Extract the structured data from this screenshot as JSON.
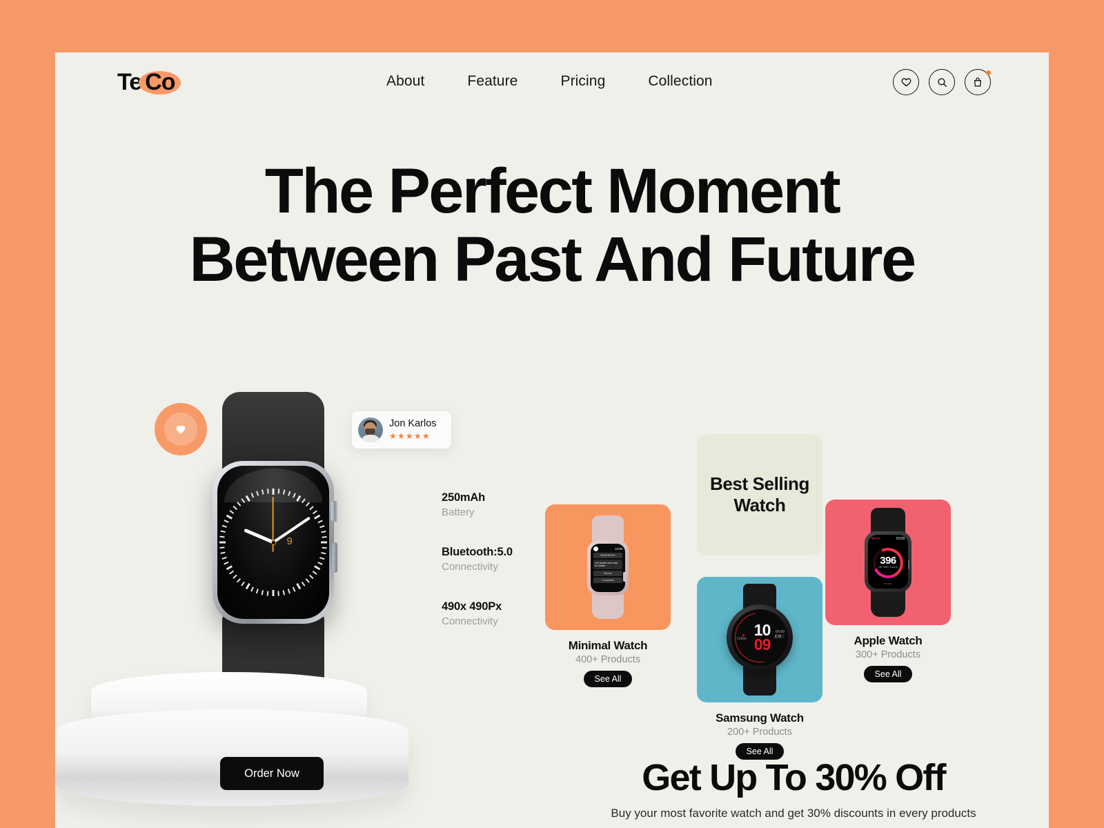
{
  "brand": {
    "name_part1": "Te",
    "name_part2": "Co",
    "accent": "#f79a68"
  },
  "nav": {
    "items": [
      {
        "label": "About"
      },
      {
        "label": "Feature"
      },
      {
        "label": "Pricing"
      },
      {
        "label": "Collection"
      }
    ]
  },
  "header_actions": [
    {
      "icon": "heart-icon",
      "label": "Wishlist"
    },
    {
      "icon": "search-icon",
      "label": "Search"
    },
    {
      "icon": "bag-icon",
      "label": "Cart",
      "badge": true
    }
  ],
  "hero": {
    "line1": "The Perfect Moment",
    "line2": "Between Past And Future"
  },
  "showcase": {
    "favorite_icon": "heart-icon",
    "review": {
      "name": "Jon Karlos",
      "stars": "★★★★★",
      "rating": 5
    },
    "specs": [
      {
        "value": "250mAh",
        "label": "Battery"
      },
      {
        "value": "Bluetooth:5.0",
        "label": "Connectivity"
      },
      {
        "value": "490x 490Px",
        "label": "Connectivity"
      }
    ],
    "watch_face": {
      "date": "9"
    },
    "order_button": "Order Now"
  },
  "best_selling": {
    "title": "Best Selling Watch"
  },
  "products": [
    {
      "title": "Minimal Watch",
      "count": "400+ Products",
      "cta": "See All",
      "color": "#f7965f",
      "screen": {
        "time": "10:09",
        "header": "REMINDERS",
        "message": "Get flowers and card for Bekah",
        "action1": "Snooze",
        "action2": "Completed"
      }
    },
    {
      "title": "Samsung Watch",
      "count": "200+ Products",
      "cta": "See All",
      "color": "#5fb6c9",
      "screen": {
        "hour": "10",
        "minute": "09",
        "distance": "119km",
        "date": "09-30",
        "weekday": "星期二"
      }
    },
    {
      "title": "Apple Watch",
      "count": "300+ Products",
      "cta": "See All",
      "color": "#f1616f",
      "screen": {
        "label": "Move",
        "time": "10:09",
        "value": "396",
        "goal": "OF 600 CALS",
        "dots": "••••"
      }
    }
  ],
  "promo": {
    "title": "Get Up To 30% Off",
    "subtitle": "Buy your most favorite watch and get 30% discounts in every products"
  }
}
